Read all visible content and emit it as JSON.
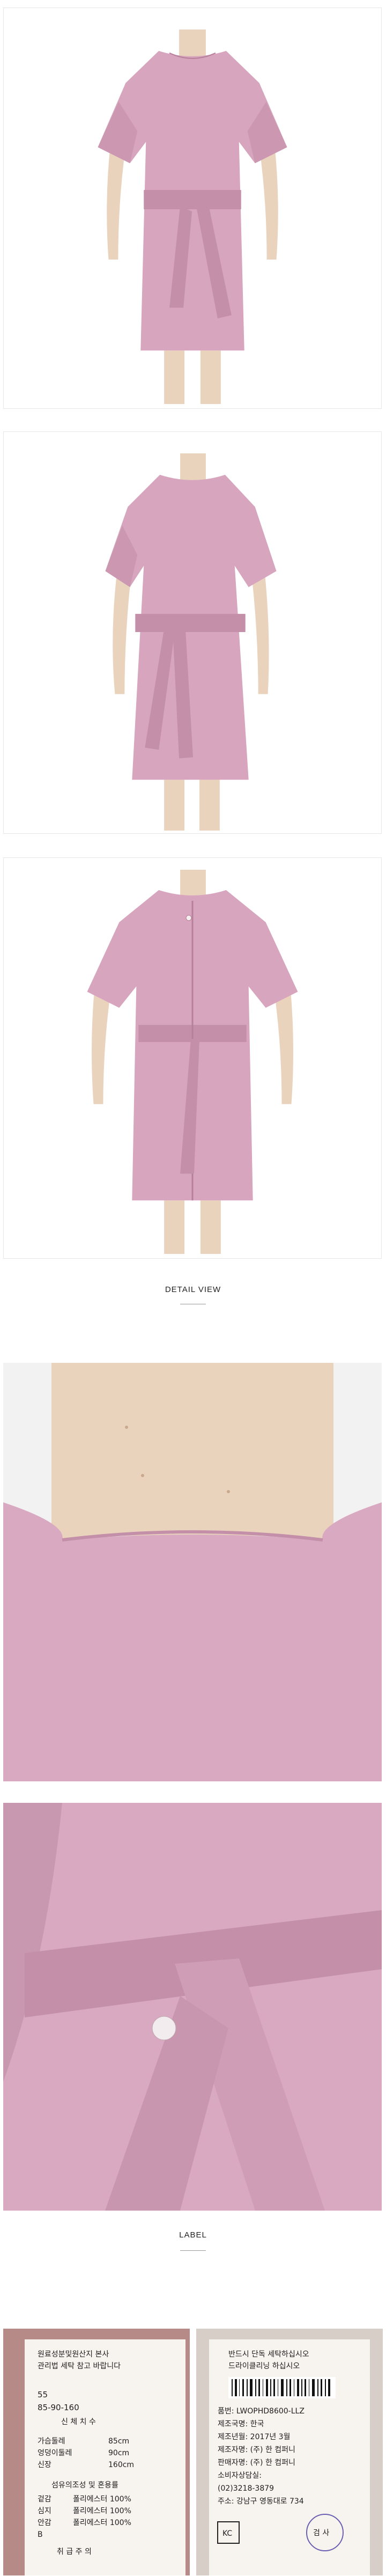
{
  "sections": {
    "detail_view": {
      "title": "DETAIL VIEW"
    },
    "label": {
      "title": "LABEL"
    }
  },
  "colors": {
    "dress": "#d7a5bd",
    "dress_shadow": "#c48fa8",
    "skin": "#ead3bd",
    "closeup_fabric": "#d9a9c1",
    "label_bg": "#f7f4ef"
  },
  "label_left": {
    "lines": [
      "원료성분및원산지 본사",
      "관리법 세탁 참고 바랍니다",
      "55",
      "85-90-160",
      "신 체 치 수",
      "가슴둘레",
      "엉덩이둘레",
      "신장",
      "섬유의조성 및 혼용률",
      "겉감",
      "심지",
      "안감",
      "B",
      "취 급 주 의"
    ],
    "values": [
      "85cm",
      "90cm",
      "160cm",
      "폴리에스터 100%",
      "폴리에스터 100%",
      "폴리에스터 100%"
    ]
  },
  "label_right": {
    "lines": [
      "반드시 단독 세탁하십시오",
      "드라이클리닝 하십시오",
      "품번: LWOPHD8600-LLZ",
      "제조국명: 한국",
      "제조년월: 2017년 3월",
      "제조자명: (주) 한 컴퍼니",
      "판매자명: (주) 한 컴퍼니",
      "소비자상담실:",
      "(02)3218-3879",
      "주소: 강남구 영동대로 734"
    ],
    "badge": "검 사"
  }
}
